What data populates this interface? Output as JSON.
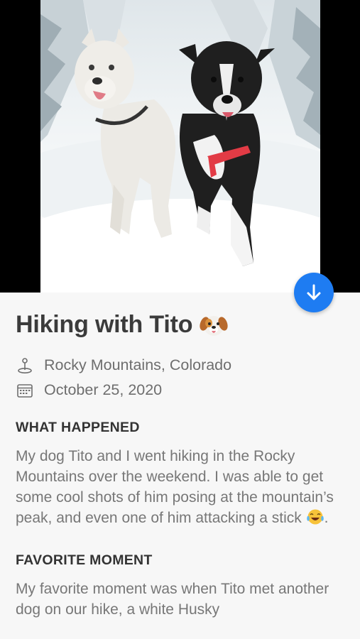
{
  "photo": {
    "alt": "Two dogs, a white husky and a black and white border collie, walking in the snow",
    "carousel": {
      "count": 3,
      "active_index": 2
    }
  },
  "download_button": {
    "icon": "arrow-down-icon"
  },
  "post": {
    "title": "Hiking with Tito",
    "title_emoji": "dog-face-emoji",
    "location": "Rocky Mountains, Colorado",
    "date": "October 25, 2020"
  },
  "sections": {
    "what_happened": {
      "heading": "WHAT HAPPENED",
      "body": "My dog Tito and I went hiking in the Rocky Mountains over the weekend. I was able to get some cool shots of him posing at the mountain’s peak, and even one of him attacking a stick",
      "trailing": ".",
      "emoji": "tears-of-joy-emoji"
    },
    "favorite_moment": {
      "heading": "FAVORITE MOMENT",
      "body": "My favorite moment was when Tito met another dog on our hike, a white Husky"
    }
  },
  "colors": {
    "accent": "#1e7cf2",
    "title": "#3b3b3b",
    "body_text": "#777777",
    "background": "#f7f7f7"
  }
}
